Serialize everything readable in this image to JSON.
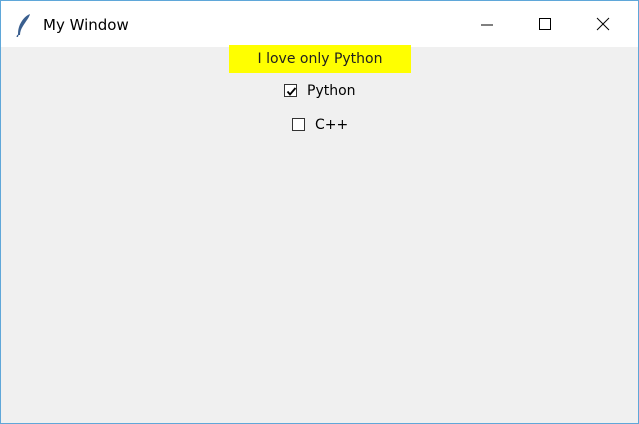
{
  "window": {
    "title": "My Window",
    "app_icon": "feather-icon",
    "controls": {
      "minimize_icon": "minimize-icon",
      "maximize_icon": "maximize-icon",
      "close_icon": "close-icon"
    }
  },
  "banner": {
    "text": "I love only Python",
    "background": "#ffff00"
  },
  "checkboxes": [
    {
      "label": "Python",
      "checked": true
    },
    {
      "label": "C++",
      "checked": false
    }
  ],
  "colors": {
    "window_border": "#5fa7d9",
    "content_background": "#f0f0f0",
    "titlebar_background": "#ffffff"
  }
}
